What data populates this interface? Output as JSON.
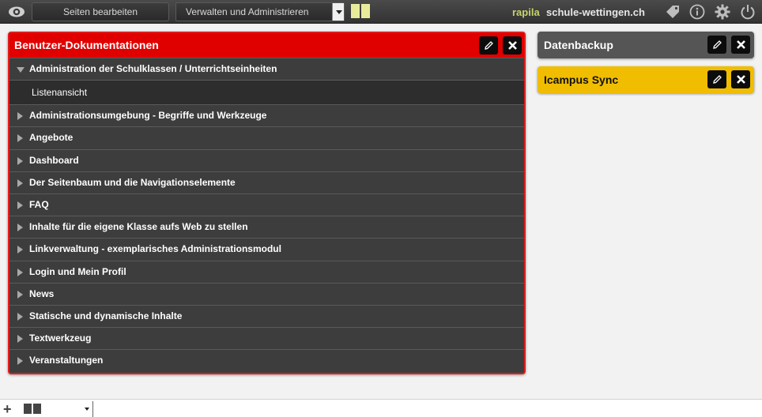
{
  "topbar": {
    "edit_pages_label": "Seiten bearbeiten",
    "mode_select_value": "Verwalten und Administrieren",
    "username": "rapila",
    "site_name": "schule-wettingen.ch"
  },
  "main_panel": {
    "title": "Benutzer-Dokumentationen",
    "items": [
      {
        "label": "Administration der Schulklassen / Unterrichtseinheiten",
        "expanded": true
      },
      {
        "label": "Listenansicht",
        "sub": true
      },
      {
        "label": "Administrationsumgebung - Begriffe und Werkzeuge"
      },
      {
        "label": "Angebote"
      },
      {
        "label": "Dashboard"
      },
      {
        "label": "Der Seitenbaum und die Navigationselemente"
      },
      {
        "label": "FAQ"
      },
      {
        "label": "Inhalte für die eigene Klasse aufs Web zu stellen"
      },
      {
        "label": "Linkverwaltung - exemplarisches Administrationsmodul"
      },
      {
        "label": "Login und Mein Profil"
      },
      {
        "label": "News"
      },
      {
        "label": "Statische und dynamische Inhalte"
      },
      {
        "label": "Textwerkzeug"
      },
      {
        "label": "Veranstaltungen"
      }
    ]
  },
  "side_panels": {
    "backup_title": "Datenbackup",
    "sync_title": "Icampus Sync"
  },
  "colors": {
    "accent_red": "#e00000",
    "sync_yellow": "#f0bd00",
    "user_green": "#c9d36a"
  },
  "icons": [
    "eye-icon",
    "tag-icon",
    "info-icon",
    "gear-icon",
    "power-icon",
    "pencil-icon",
    "close-icon",
    "plus-icon"
  ]
}
